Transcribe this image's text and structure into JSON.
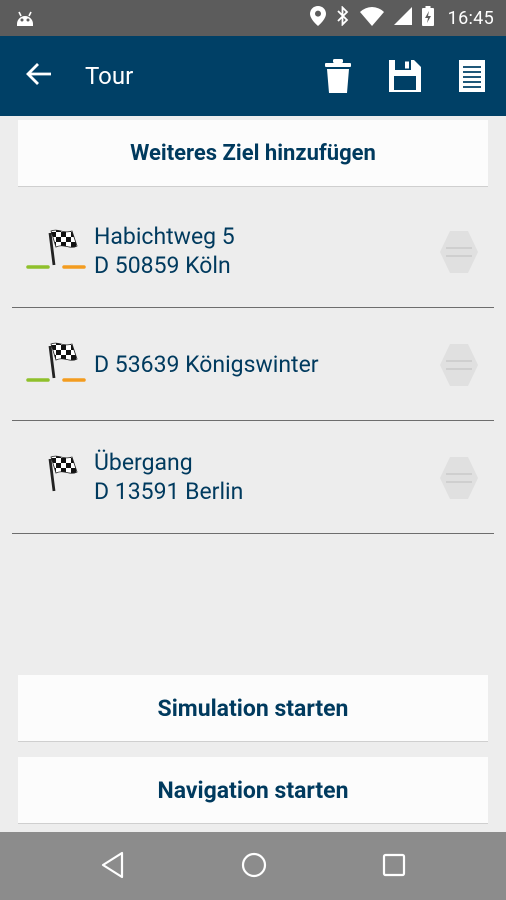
{
  "status_bar": {
    "time": "16:45",
    "icons": [
      "android-icon",
      "location-icon",
      "bluetooth-icon",
      "wifi-icon",
      "signal-icon",
      "battery-icon"
    ]
  },
  "app_bar": {
    "title": "Tour",
    "actions": [
      "delete-icon",
      "save-icon",
      "list-icon"
    ],
    "color": "#004066"
  },
  "add_destination": {
    "label": "Weiteres Ziel hinzufügen"
  },
  "destinations": [
    {
      "line1": "Habichtweg 5",
      "line2": "D 50859 Köln",
      "route_colors": true
    },
    {
      "line1": "D 53639 Königswinter",
      "line2": "",
      "route_colors": true
    },
    {
      "line1": "Übergang",
      "line2": "D 13591 Berlin",
      "route_colors": false
    }
  ],
  "buttons": {
    "simulation": "Simulation starten",
    "navigation": "Navigation starten"
  },
  "colors": {
    "text": "#003a5e",
    "route_green": "#8fc02b",
    "route_orange": "#f39c1f"
  },
  "nav_bar": [
    "back-triangle-icon",
    "home-circle-icon",
    "recents-square-icon"
  ]
}
